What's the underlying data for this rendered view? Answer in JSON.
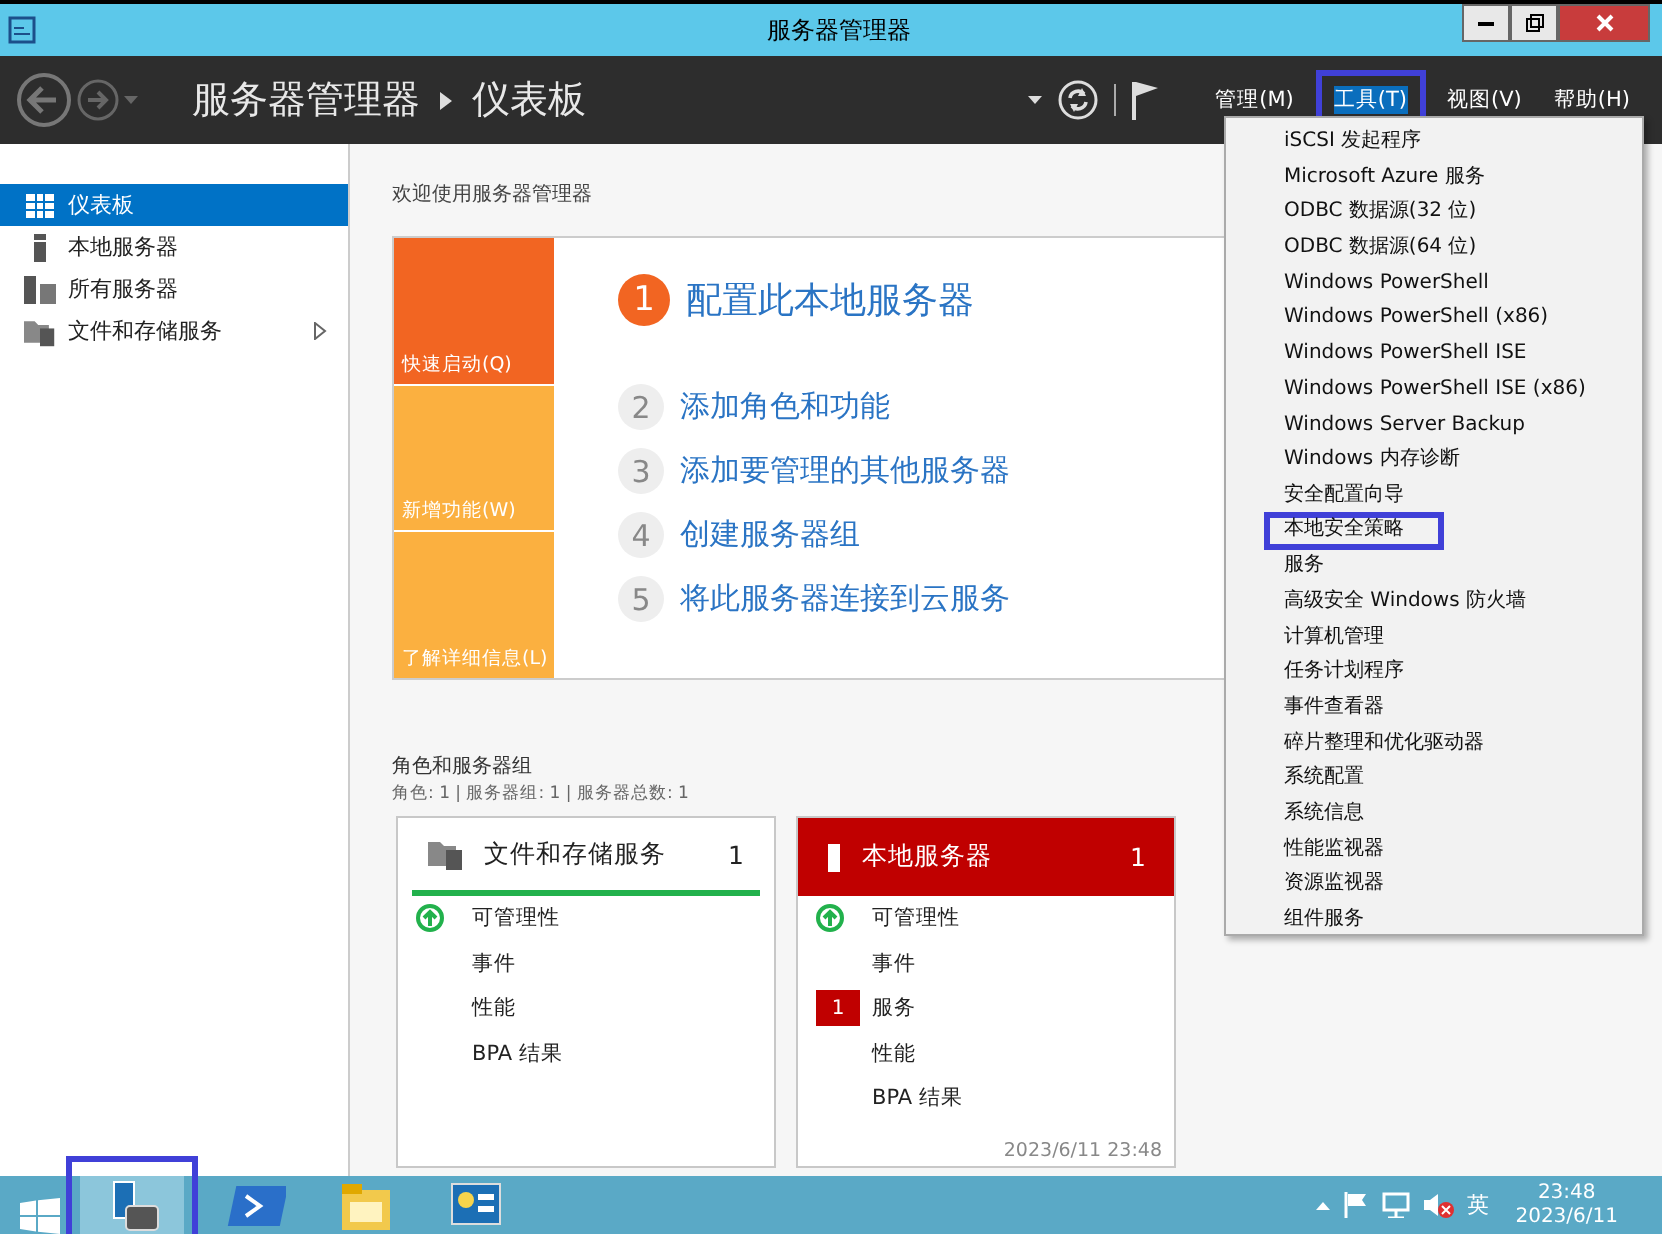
{
  "window": {
    "title": "服务器管理器"
  },
  "header": {
    "crumbs": [
      "服务器管理器",
      "仪表板"
    ]
  },
  "menubar": [
    {
      "label": "管理(M)",
      "selected": false,
      "annotated": false
    },
    {
      "label": "工具(T)",
      "selected": true,
      "annotated": true
    },
    {
      "label": "视图(V)",
      "selected": false,
      "annotated": false
    },
    {
      "label": "帮助(H)",
      "selected": false,
      "annotated": false
    }
  ],
  "tools_menu": {
    "items": [
      {
        "label": "iSCSI 发起程序",
        "annotated": false
      },
      {
        "label": "Microsoft Azure 服务",
        "annotated": false
      },
      {
        "label": "ODBC 数据源(32 位)",
        "annotated": false
      },
      {
        "label": "ODBC 数据源(64 位)",
        "annotated": false
      },
      {
        "label": "Windows PowerShell",
        "annotated": false
      },
      {
        "label": "Windows PowerShell (x86)",
        "annotated": false
      },
      {
        "label": "Windows PowerShell ISE",
        "annotated": false
      },
      {
        "label": "Windows PowerShell ISE (x86)",
        "annotated": false
      },
      {
        "label": "Windows Server Backup",
        "annotated": false
      },
      {
        "label": "Windows 内存诊断",
        "annotated": false
      },
      {
        "label": "安全配置向导",
        "annotated": false
      },
      {
        "label": "本地安全策略",
        "annotated": true
      },
      {
        "label": "服务",
        "annotated": false
      },
      {
        "label": "高级安全 Windows 防火墙",
        "annotated": false
      },
      {
        "label": "计算机管理",
        "annotated": false
      },
      {
        "label": "任务计划程序",
        "annotated": false
      },
      {
        "label": "事件查看器",
        "annotated": false
      },
      {
        "label": "碎片整理和优化驱动器",
        "annotated": false
      },
      {
        "label": "系统配置",
        "annotated": false
      },
      {
        "label": "系统信息",
        "annotated": false
      },
      {
        "label": "性能监视器",
        "annotated": false
      },
      {
        "label": "资源监视器",
        "annotated": false
      },
      {
        "label": "组件服务",
        "annotated": false
      }
    ]
  },
  "sidebar": {
    "items": [
      {
        "label": "仪表板",
        "kind": "dashboard",
        "selected": true,
        "expandable": false
      },
      {
        "label": "本地服务器",
        "kind": "server",
        "selected": false,
        "expandable": false
      },
      {
        "label": "所有服务器",
        "kind": "servers",
        "selected": false,
        "expandable": false
      },
      {
        "label": "文件和存储服务",
        "kind": "files",
        "selected": false,
        "expandable": true
      }
    ]
  },
  "welcome": {
    "title": "欢迎使用服务器管理器",
    "tiles": [
      {
        "label": "快速启动(Q)",
        "color": "#f26522"
      },
      {
        "label": "新增功能(W)",
        "color": "#fbb040"
      },
      {
        "label": "了解详细信息(L)",
        "color": "#fbb040"
      }
    ],
    "steps": [
      {
        "number": "1",
        "label": "配置此本地服务器",
        "primary": true
      },
      {
        "number": "2",
        "label": "添加角色和功能",
        "primary": false
      },
      {
        "number": "3",
        "label": "添加要管理的其他服务器",
        "primary": false
      },
      {
        "number": "4",
        "label": "创建服务器组",
        "primary": false
      },
      {
        "number": "5",
        "label": "将此服务器连接到云服务",
        "primary": false
      }
    ]
  },
  "roles": {
    "title": "角色和服务器组",
    "summary": "角色: 1 | 服务器组: 1 | 服务器总数: 1",
    "cards": [
      {
        "title": "文件和存储服务",
        "count": "1",
        "kind": "files",
        "alert": false,
        "rows": [
          {
            "label": "可管理性",
            "ok": true
          },
          {
            "label": "事件"
          },
          {
            "label": "性能"
          },
          {
            "label": "BPA 结果"
          }
        ]
      },
      {
        "title": "本地服务器",
        "count": "1",
        "kind": "server",
        "alert": true,
        "timestamp": "2023/6/11 23:48",
        "rows": [
          {
            "label": "可管理性",
            "ok": true
          },
          {
            "label": "事件"
          },
          {
            "label": "服务",
            "badge": "1"
          },
          {
            "label": "性能"
          },
          {
            "label": "BPA 结果"
          }
        ]
      }
    ]
  },
  "taskbar": {
    "apps": [
      {
        "kind": "server-manager",
        "selected": true,
        "annotated": true
      },
      {
        "kind": "powershell",
        "selected": false,
        "annotated": false
      },
      {
        "kind": "explorer",
        "selected": false,
        "annotated": false
      },
      {
        "kind": "control",
        "selected": false,
        "annotated": false
      }
    ],
    "tray": {
      "language": "英",
      "time": "23:48",
      "date": "2023/6/11"
    }
  }
}
